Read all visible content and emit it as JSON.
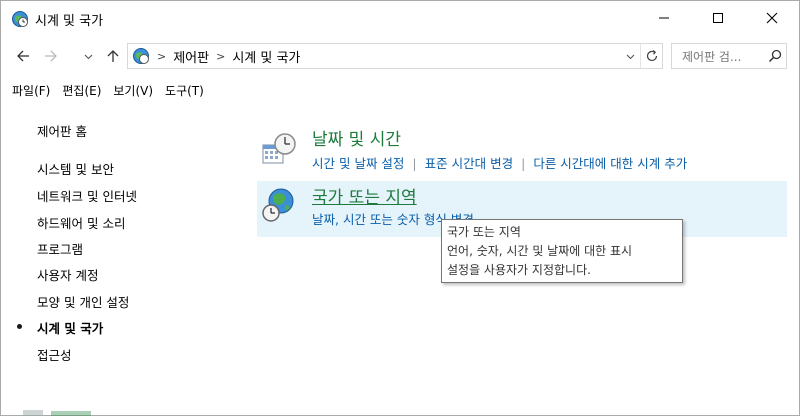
{
  "window": {
    "title": "시계 및 국가",
    "icon": "control-panel-clock-icon"
  },
  "address": {
    "breadcrumbs": [
      "제어판",
      "시계 및 국가"
    ],
    "search_placeholder": "제어판 검..."
  },
  "menu": {
    "items": [
      "파일(F)",
      "편집(E)",
      "보기(V)",
      "도구(T)"
    ]
  },
  "sidebar": {
    "home": "제어판 홈",
    "items": [
      {
        "label": "시스템 및 보안",
        "current": false
      },
      {
        "label": "네트워크 및 인터넷",
        "current": false
      },
      {
        "label": "하드웨어 및 소리",
        "current": false
      },
      {
        "label": "프로그램",
        "current": false
      },
      {
        "label": "사용자 계정",
        "current": false
      },
      {
        "label": "모양 및 개인 설정",
        "current": false
      },
      {
        "label": "시계 및 국가",
        "current": true
      },
      {
        "label": "접근성",
        "current": false
      }
    ]
  },
  "categories": [
    {
      "title": "날짜 및 시간",
      "icon": "clock-calendar-icon",
      "links": [
        "시간 및 날짜 설정",
        "표준 시간대 변경",
        "다른 시간대에 대한 시계 추가"
      ]
    },
    {
      "title": "국가 또는 지역",
      "icon": "globe-clock-icon",
      "links": [
        "날짜, 시간 또는 숫자 형식 변경"
      ]
    }
  ],
  "tooltip": {
    "lines": [
      "국가 또는 지역",
      "언어, 숫자, 시간 및 날짜에 대한 표시",
      "설정을 사용자가 지정합니다."
    ]
  },
  "colors": {
    "category_title": "#1e7b3d",
    "link": "#0a5ea8",
    "hover_bg": "#e5f3fb"
  }
}
